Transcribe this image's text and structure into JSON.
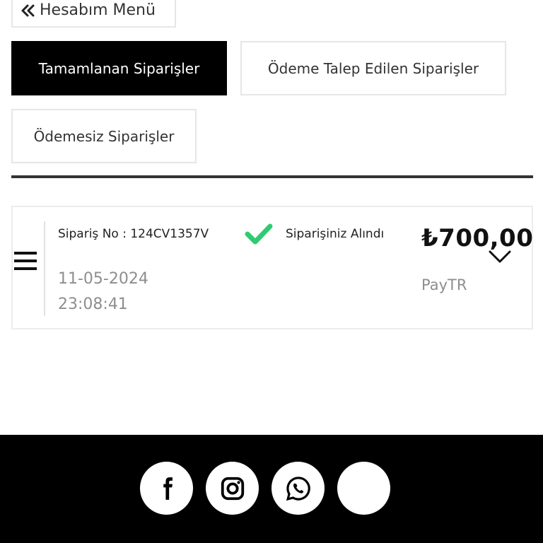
{
  "back_button": {
    "label": "Hesabım Menü",
    "icon": "double-chevron-left-icon"
  },
  "tabs": [
    {
      "label": "Tamamlanan Siparişler",
      "active": true
    },
    {
      "label": "Ödeme Talep Edilen Siparişler",
      "active": false
    },
    {
      "label": "Ödemesiz Siparişler",
      "active": false
    }
  ],
  "order": {
    "order_no": "Sipariş No : 124CV1357V",
    "date": "11-05-2024",
    "time": "23:08:41",
    "status": "Siparişiniz Alındı",
    "price": "₺700,00",
    "payment_method": "PayTR",
    "status_color": "#2ecc71"
  },
  "footer": {
    "social": [
      "facebook-icon",
      "instagram-icon",
      "whatsapp-icon",
      "blank-icon"
    ],
    "background": "#000000"
  }
}
